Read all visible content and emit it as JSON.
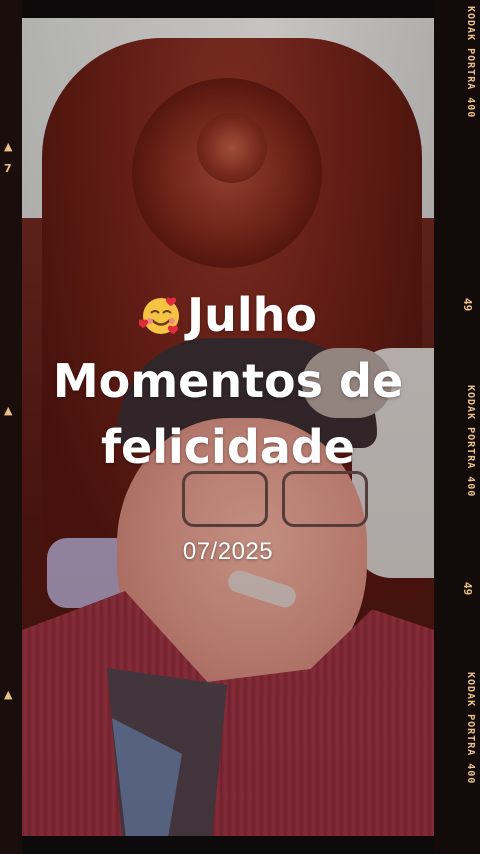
{
  "overlay": {
    "emoji_icon": "smiling-face-with-hearts-icon",
    "title_line1": "Julho",
    "title_line2": "Momentos de",
    "title_line3": "felicidade",
    "date": "07/2025"
  },
  "film": {
    "brand_label_1": "KODAK PORTRA 400",
    "brand_label_2": "KODAK PORTRA 400",
    "brand_label_3": "KODAK PORTRA 400",
    "frame_number_1": "49",
    "frame_number_2": "49",
    "left_number": "7"
  },
  "colors": {
    "text": "#ffffff",
    "film_text": "#e9c08a",
    "robe": "#8b2e3d",
    "headboard": "#6a2218"
  }
}
